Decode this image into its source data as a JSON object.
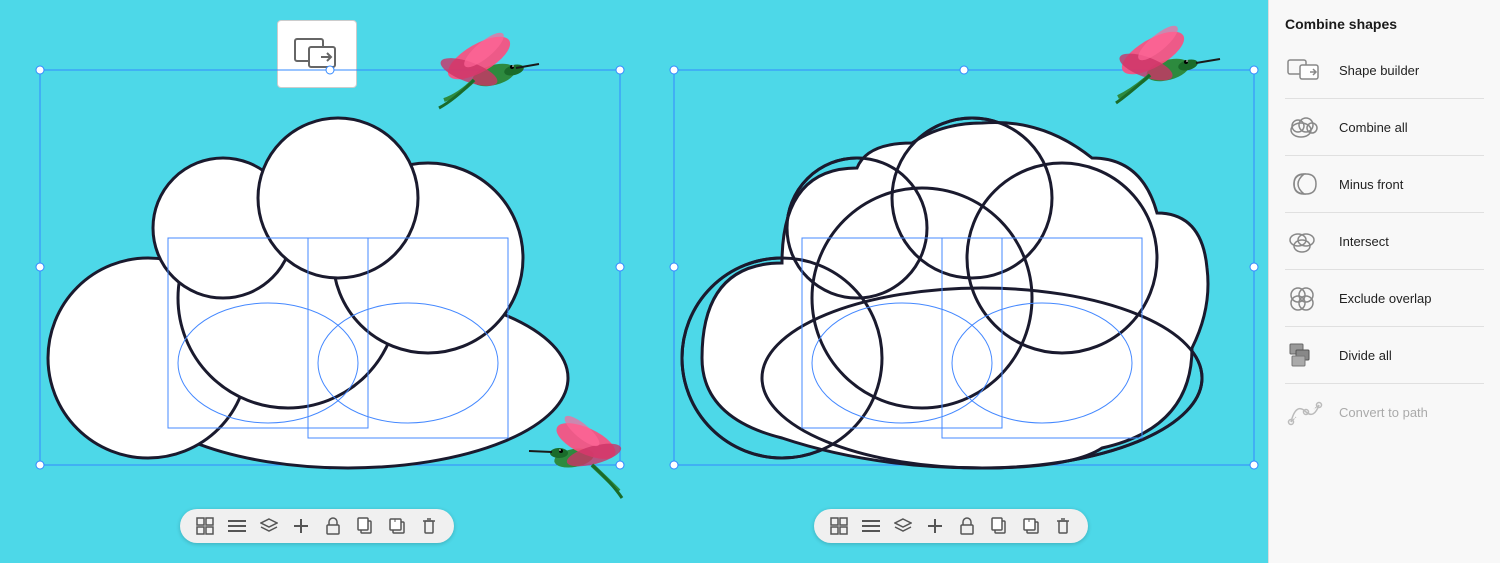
{
  "sidebar": {
    "title": "Combine shapes",
    "items": [
      {
        "id": "shape-builder",
        "label": "Shape builder",
        "disabled": false
      },
      {
        "id": "combine-all",
        "label": "Combine all",
        "disabled": false
      },
      {
        "id": "minus-front",
        "label": "Minus front",
        "disabled": false
      },
      {
        "id": "intersect",
        "label": "Intersect",
        "disabled": false
      },
      {
        "id": "exclude-overlap",
        "label": "Exclude overlap",
        "disabled": false
      },
      {
        "id": "divide-all",
        "label": "Divide all",
        "disabled": false
      },
      {
        "id": "convert-to-path",
        "label": "Convert to path",
        "disabled": true
      }
    ]
  },
  "toolbar": {
    "buttons": [
      "⊞",
      "≡",
      "⇅",
      "+",
      "🔓",
      "❐",
      "❐+",
      "🗑"
    ]
  },
  "canvas": {
    "bg_color": "#4dd8e8"
  }
}
